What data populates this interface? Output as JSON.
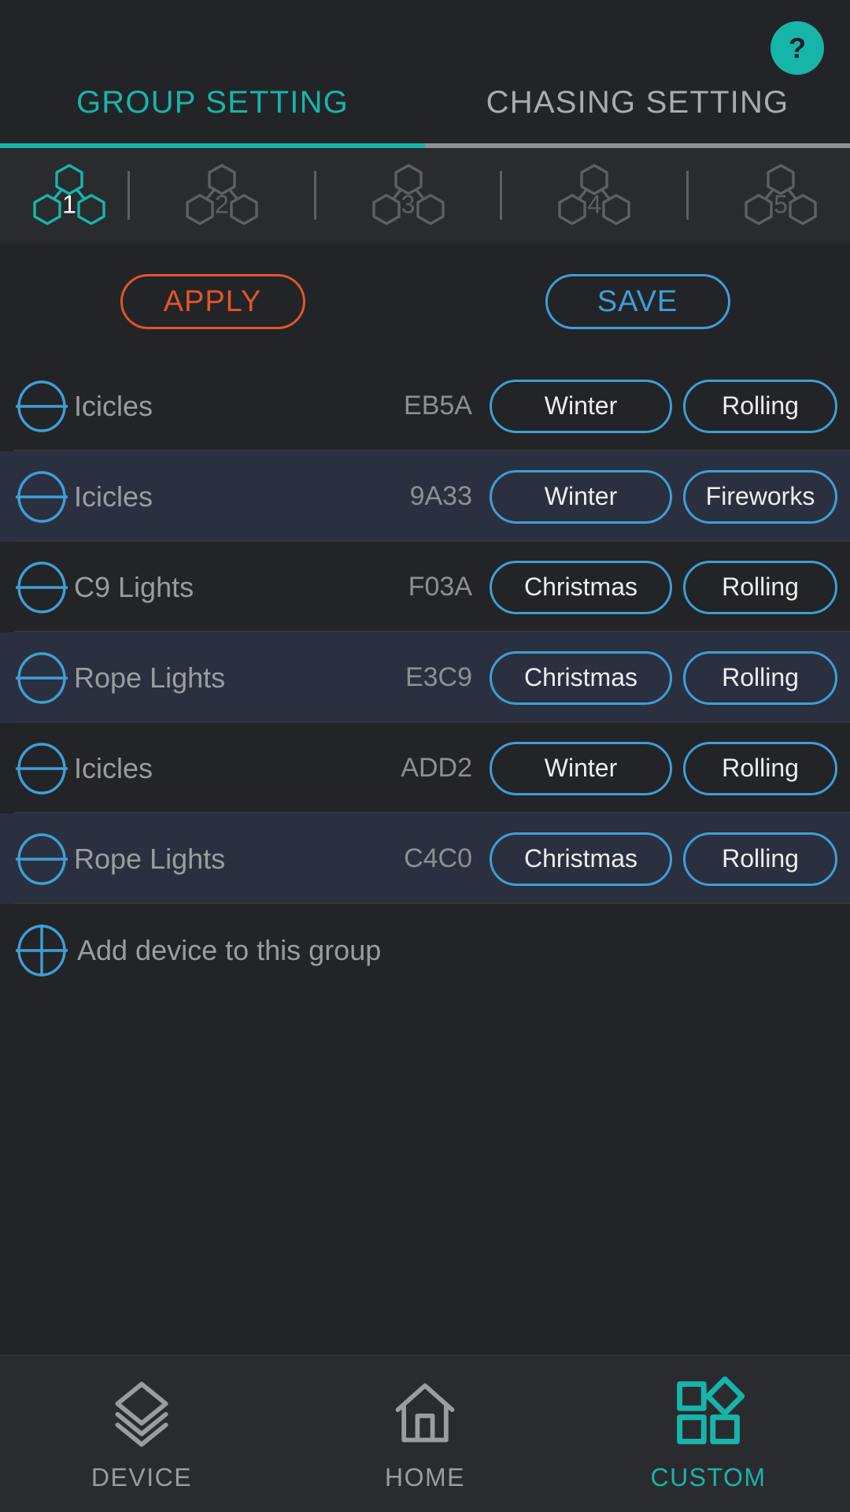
{
  "colors": {
    "accent_teal": "#16b5aa",
    "accent_blue": "#3d9fd6",
    "accent_orange": "#e2552c",
    "background": "#232427",
    "row_alt": "#2b3040",
    "muted_text": "#9a9ca0"
  },
  "header": {
    "help_icon": "help-question-icon",
    "tabs": [
      {
        "label": "GROUP SETTING",
        "active": true
      },
      {
        "label": "CHASING SETTING",
        "active": false
      }
    ]
  },
  "group_selector": {
    "groups": [
      {
        "number": "1",
        "active": true
      },
      {
        "number": "2",
        "active": false
      },
      {
        "number": "3",
        "active": false
      },
      {
        "number": "4",
        "active": false
      },
      {
        "number": "5",
        "active": false
      }
    ]
  },
  "actions": {
    "apply_label": "APPLY",
    "save_label": "SAVE"
  },
  "device_list": {
    "rows": [
      {
        "icon": "minus-circle-icon",
        "name": "Icicles",
        "id": "EB5A",
        "scene": "Winter",
        "effect": "Rolling"
      },
      {
        "icon": "minus-circle-icon",
        "name": "Icicles",
        "id": "9A33",
        "scene": "Winter",
        "effect": "Fireworks"
      },
      {
        "icon": "minus-circle-icon",
        "name": "C9 Lights",
        "id": "F03A",
        "scene": "Christmas",
        "effect": "Rolling"
      },
      {
        "icon": "minus-circle-icon",
        "name": "Rope Lights",
        "id": "E3C9",
        "scene": "Christmas",
        "effect": "Rolling"
      },
      {
        "icon": "minus-circle-icon",
        "name": "Icicles",
        "id": "ADD2",
        "scene": "Winter",
        "effect": "Rolling"
      },
      {
        "icon": "minus-circle-icon",
        "name": "Rope Lights",
        "id": "C4C0",
        "scene": "Christmas",
        "effect": "Rolling"
      }
    ],
    "add_row": {
      "icon": "plus-circle-icon",
      "label": "Add device to this group"
    }
  },
  "bottom_nav": {
    "items": [
      {
        "label": "DEVICE",
        "icon": "layers-icon",
        "active": false
      },
      {
        "label": "HOME",
        "icon": "home-icon",
        "active": false
      },
      {
        "label": "CUSTOM",
        "icon": "widgets-icon",
        "active": true
      }
    ]
  }
}
